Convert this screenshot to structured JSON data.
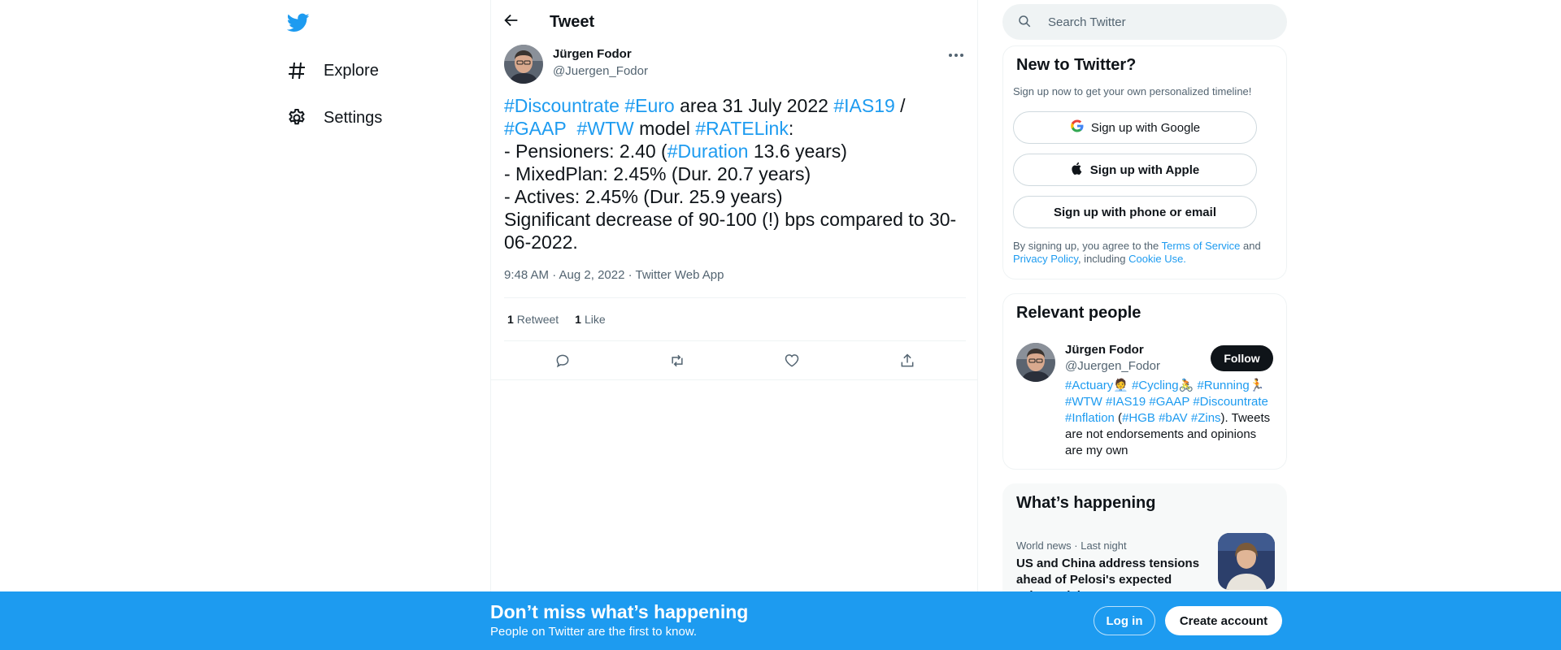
{
  "nav": {
    "items": [
      {
        "label": "Explore",
        "icon": "hashtag-icon"
      },
      {
        "label": "Settings",
        "icon": "gear-icon"
      }
    ]
  },
  "header": {
    "title": "Tweet"
  },
  "tweet": {
    "author_name": "Jürgen Fodor",
    "author_handle": "@Juergen_Fodor",
    "text": {
      "l1_tag1": "#Discountrate",
      "l1_tag2": "#Euro",
      "l1_mid": " area 31 July 2022 ",
      "l1_tag3": "#IAS19",
      "l1_end": " /",
      "l2_tag1": "#GAAP",
      "l2_tag2": "#WTW",
      "l2_mid": " model ",
      "l2_tag3": "#RATELink",
      "l2_end": ":",
      "l3_pre": "- Pensioners: 2.40 (",
      "l3_tag": "#Duration",
      "l3_end": " 13.6 years)",
      "l4": "- MixedPlan: 2.45% (Dur. 20.7 years)",
      "l5": "- Actives: 2.45% (Dur. 25.9 years)",
      "l6": "Significant decrease of 90-100 (!) bps compared to 30-06-2022."
    },
    "meta": "9:48 AM · Aug 2, 2022 · Twitter Web App",
    "retweets_count": "1",
    "retweets_label": "Retweet",
    "likes_count": "1",
    "likes_label": "Like"
  },
  "search": {
    "placeholder": "Search Twitter"
  },
  "new_to_twitter": {
    "title": "New to Twitter?",
    "subtitle": "Sign up now to get your own personalized timeline!",
    "google_label": "Sign up with Google",
    "apple_label": "Sign up with Apple",
    "phone_label": "Sign up with phone or email",
    "legal_pre": "By signing up, you agree to the ",
    "terms": "Terms of Service",
    "and": " and ",
    "privacy": "Privacy Policy",
    "including": ", including ",
    "cookie": "Cookie Use."
  },
  "relevant_people": {
    "title": "Relevant people",
    "name": "Jürgen Fodor",
    "handle": "@Juergen_Fodor",
    "follow_label": "Follow",
    "bio": {
      "t1": "#Actuary",
      "e1": "🧑‍💼",
      "t2": "#Cycling",
      "e2": "🚴",
      "t3": "#Running",
      "e3": "🏃",
      "t4": "#WTW",
      "t5": "#IAS19",
      "t6": "#GAAP",
      "t7": "#Discountrate",
      "t8": "#Inflation",
      "p1": " (",
      "t9": "#HGB",
      "t10": "#bAV",
      "t11": "#Zins",
      "p2": ").",
      "tail": "Tweets are not endorsements and opinions are my own"
    }
  },
  "whats_happening": {
    "title": "What’s happening",
    "meta": "World news · Last night",
    "headline": "US and China address tensions ahead of Pelosi's expected Taiwan visit"
  },
  "banner": {
    "title": "Don’t miss what’s happening",
    "subtitle": "People on Twitter are the first to know.",
    "login_label": "Log in",
    "create_label": "Create account"
  },
  "colors": {
    "accent": "#1d9bf0",
    "text": "#0f1419",
    "secondary": "#536471"
  }
}
